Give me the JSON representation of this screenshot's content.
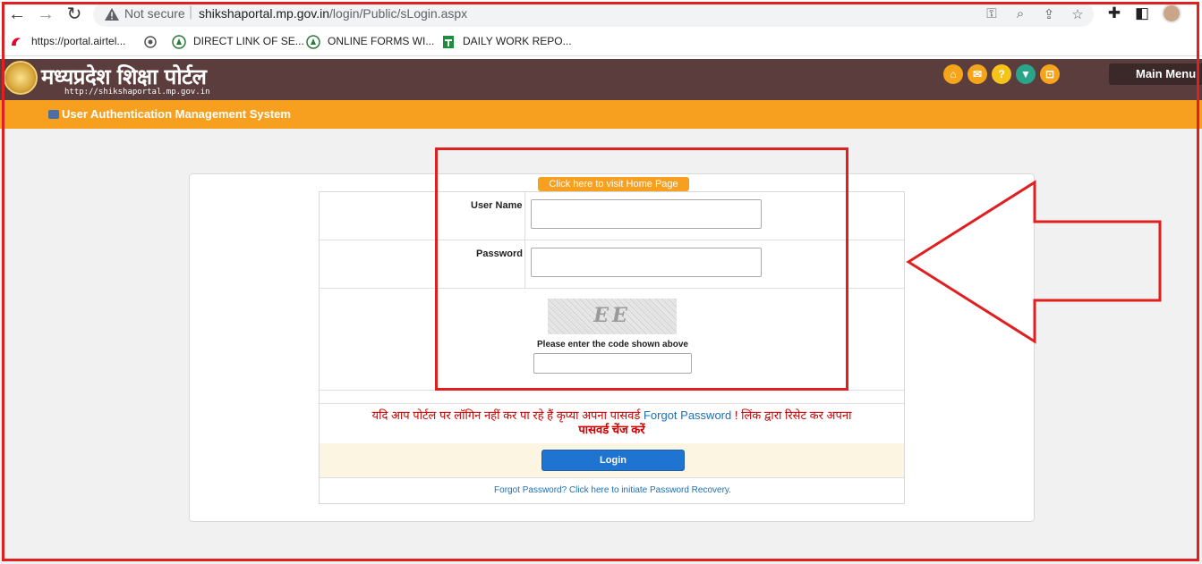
{
  "browser": {
    "not_secure": "Not secure",
    "url_host": "shikshaportal.mp.gov.in",
    "url_path": "/login/Public/sLogin.aspx",
    "bookmarks": [
      "https://portal.airtel...",
      "DIRECT LINK OF SE...",
      "ONLINE FORMS WI...",
      "DAILY WORK REPO..."
    ]
  },
  "header": {
    "logo_title": "मध्यप्रदेश शिक्षा पोर्टल",
    "logo_url": "http://shikshaportal.mp.gov.in",
    "main_menu": "Main Menu",
    "icons": [
      "home-icon",
      "mail-icon",
      "help-icon",
      "trophy-icon",
      "lock-icon"
    ],
    "subtitle": "User Authentication Management System"
  },
  "login": {
    "home_link": "Click here to visit Home Page",
    "username_label": "User Name",
    "username_value": "",
    "password_label": "Password",
    "password_value": "",
    "captcha_text": "EE",
    "captcha_hint": "Please enter the code shown above",
    "captcha_value": "",
    "notice_part1": "यदि आप पोर्टल पर लॉगिन नहीं कर पा रहे हैं कृप्या अपना पासवर्ड",
    "notice_link": "Forgot Password",
    "notice_part2": "! लिंक द्वारा रिसेट कर अपना",
    "notice_part3": "पासवर्ड चेंज करें",
    "login_button": "Login",
    "forgot_link": "Forgot Password? Click here to initiate Password Recovery."
  },
  "colors": {
    "header_bg": "#5c3d3e",
    "accent_orange": "#f7a020",
    "button_blue": "#1f74d2",
    "annotation_red": "#e02020"
  }
}
